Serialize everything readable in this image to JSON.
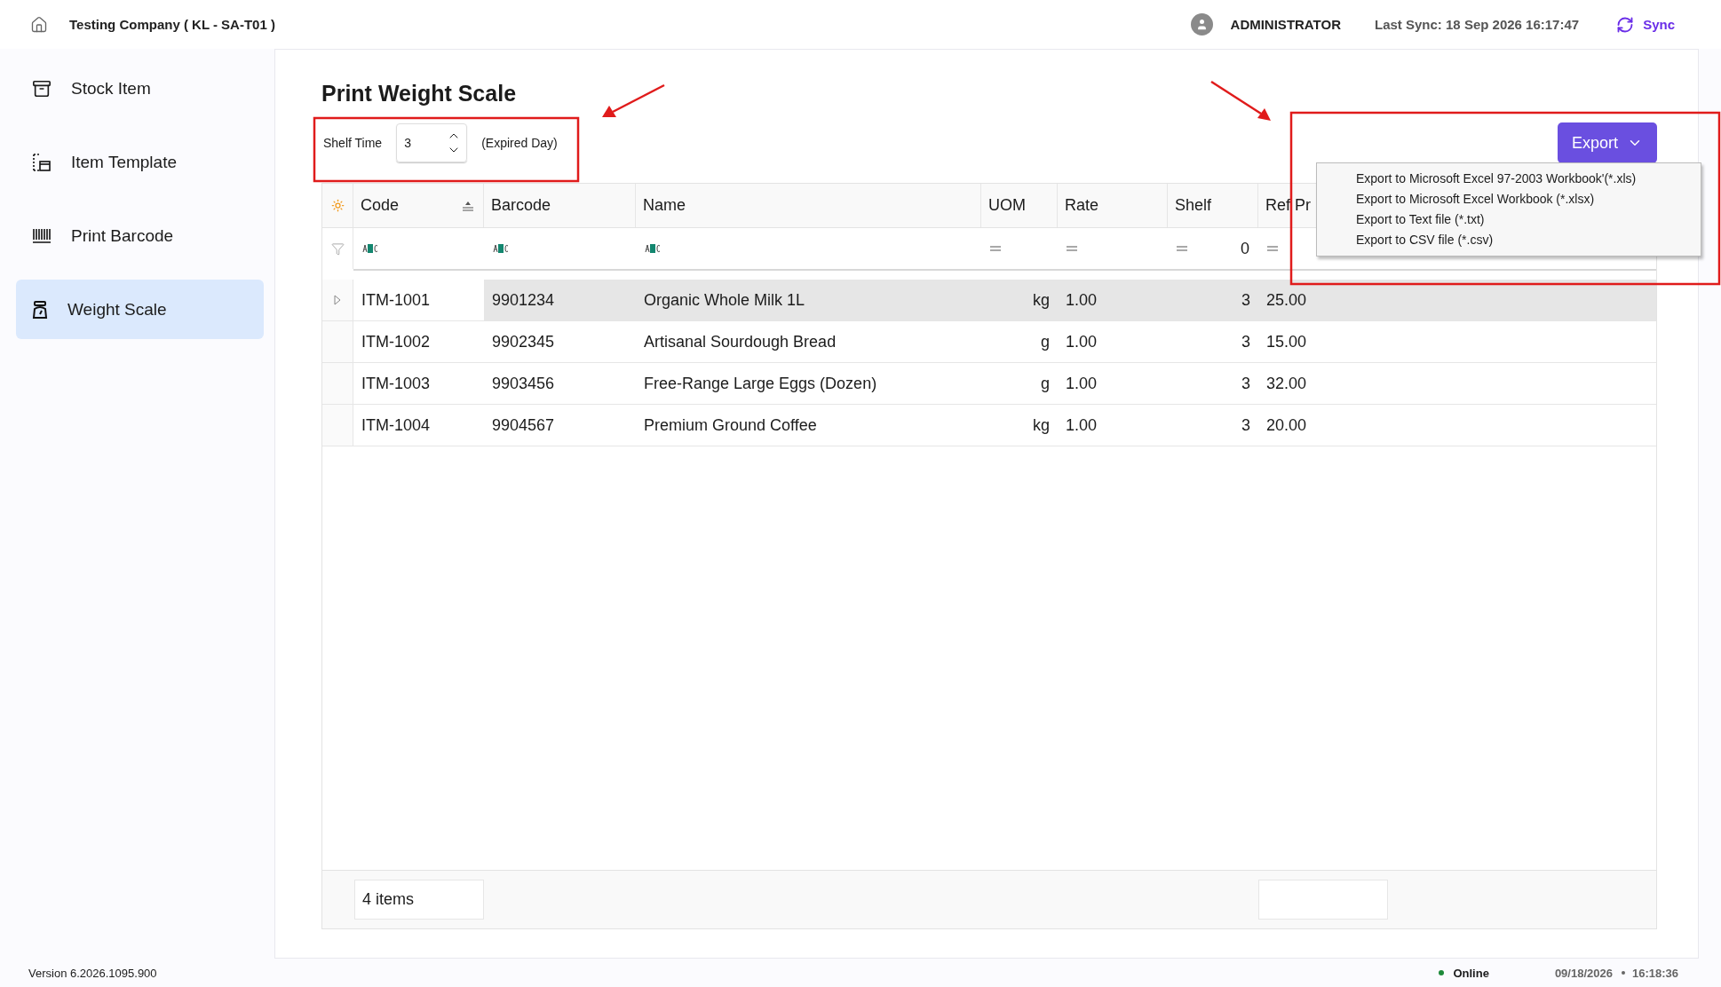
{
  "header": {
    "company": "Testing Company ( KL - SA-T01 )",
    "user": "ADMINISTRATOR",
    "last_sync": "Last Sync: 18 Sep 2026 16:17:47",
    "sync_button": "Sync"
  },
  "sidebar": {
    "items": [
      {
        "label": "Stock Item",
        "kind": "box",
        "selected": false
      },
      {
        "label": "Item Template",
        "kind": "template",
        "selected": false
      },
      {
        "label": "Print Barcode",
        "kind": "barcode",
        "selected": false
      },
      {
        "label": "Weight Scale",
        "kind": "scale",
        "selected": true
      }
    ]
  },
  "page": {
    "title": "Print Weight Scale",
    "shelf_time": {
      "label": "Shelf Time",
      "value": "3",
      "suffix": "(Expired Day)"
    },
    "export": {
      "label": "Export",
      "expanded": true,
      "menu": [
        "Export to Microsoft Excel 97-2003 Workbook'(*.xls)",
        "Export to Microsoft Excel Workbook (*.xlsx)",
        "Export to Text file (*.txt)",
        "Export to CSV file (*.csv)"
      ]
    }
  },
  "grid": {
    "columns": [
      {
        "label": "Code",
        "sorted": true,
        "kind": "text"
      },
      {
        "label": "Barcode",
        "sorted": false,
        "kind": "text"
      },
      {
        "label": "Name",
        "sorted": false,
        "kind": "text"
      },
      {
        "label": "UOM",
        "sorted": false,
        "kind": "number"
      },
      {
        "label": "Rate",
        "sorted": false,
        "kind": "number"
      },
      {
        "label": "Shelf",
        "sorted": false,
        "kind": "number",
        "filter_value": "0"
      },
      {
        "label": "Ref Pr",
        "sorted": false,
        "kind": "number"
      }
    ],
    "rows": [
      {
        "selected": true,
        "cells": [
          "ITM-1001",
          "9901234",
          "Organic Whole Milk 1L",
          "kg",
          "1.00",
          "3",
          "25.00"
        ]
      },
      {
        "selected": false,
        "cells": [
          "ITM-1002",
          "9902345",
          "Artisanal Sourdough Bread",
          "g",
          "1.00",
          "3",
          "15.00"
        ]
      },
      {
        "selected": false,
        "cells": [
          "ITM-1003",
          "9903456",
          "Free-Range Large Eggs (Dozen)",
          "g",
          "1.00",
          "3",
          "32.00"
        ]
      },
      {
        "selected": false,
        "cells": [
          "ITM-1004",
          "9904567",
          "Premium Ground Coffee",
          "kg",
          "1.00",
          "3",
          "20.00"
        ]
      }
    ],
    "footer": {
      "count": "4 items"
    }
  },
  "status_bar": {
    "version": "Version 6.2026.1095.900",
    "connection": "Online",
    "online": true,
    "date": "09/18/2026",
    "time": "16:18:36"
  }
}
